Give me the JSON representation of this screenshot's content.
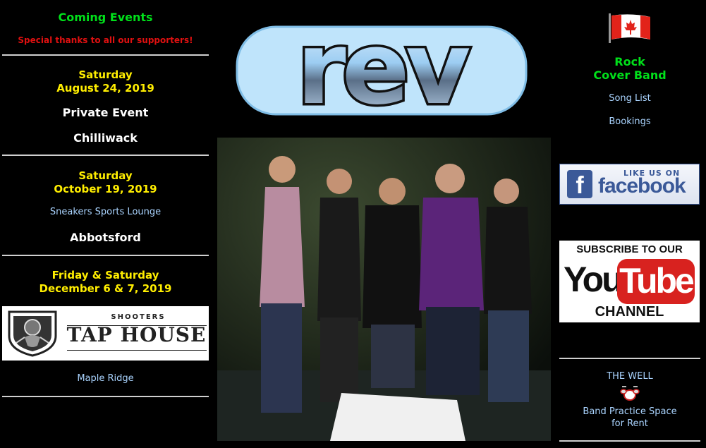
{
  "left": {
    "heading": "Coming Events",
    "thanks": "Special thanks to all our supporters!",
    "events": [
      {
        "day": "Saturday",
        "date": "August 24, 2019",
        "name": "Private Event",
        "location": "Chilliwack"
      },
      {
        "day": "Saturday",
        "date": "October 19, 2019",
        "venue": "Sneakers Sports Lounge",
        "location": "Abbotsford"
      },
      {
        "day": "Friday & Saturday",
        "date": "December 6 & 7, 2019",
        "venue_logo_top": "SHOOTERS",
        "venue_logo_name": "TAP HOUSE",
        "location": "Maple Ridge"
      }
    ]
  },
  "logo": {
    "text": "rev"
  },
  "right": {
    "tagline_line1": "Rock",
    "tagline_line2": "Cover Band",
    "song_list": "Song List",
    "bookings": "Bookings",
    "facebook": {
      "like": "LIKE US ON",
      "word": "facebook",
      "f": "f"
    },
    "youtube": {
      "subscribe": "SUBSCRIBE TO OUR",
      "you": "You",
      "tube": "Tube",
      "channel": "CHANNEL"
    },
    "well_title": "THE WELL",
    "well_line1": "Band Practice Space",
    "well_line2": "for Rent"
  },
  "colors": {
    "green": "#00e01a",
    "yellow": "#ffee00",
    "red": "#e01010",
    "link": "#aad4ff",
    "facebook_blue": "#3b5998",
    "youtube_red": "#d8221f"
  }
}
